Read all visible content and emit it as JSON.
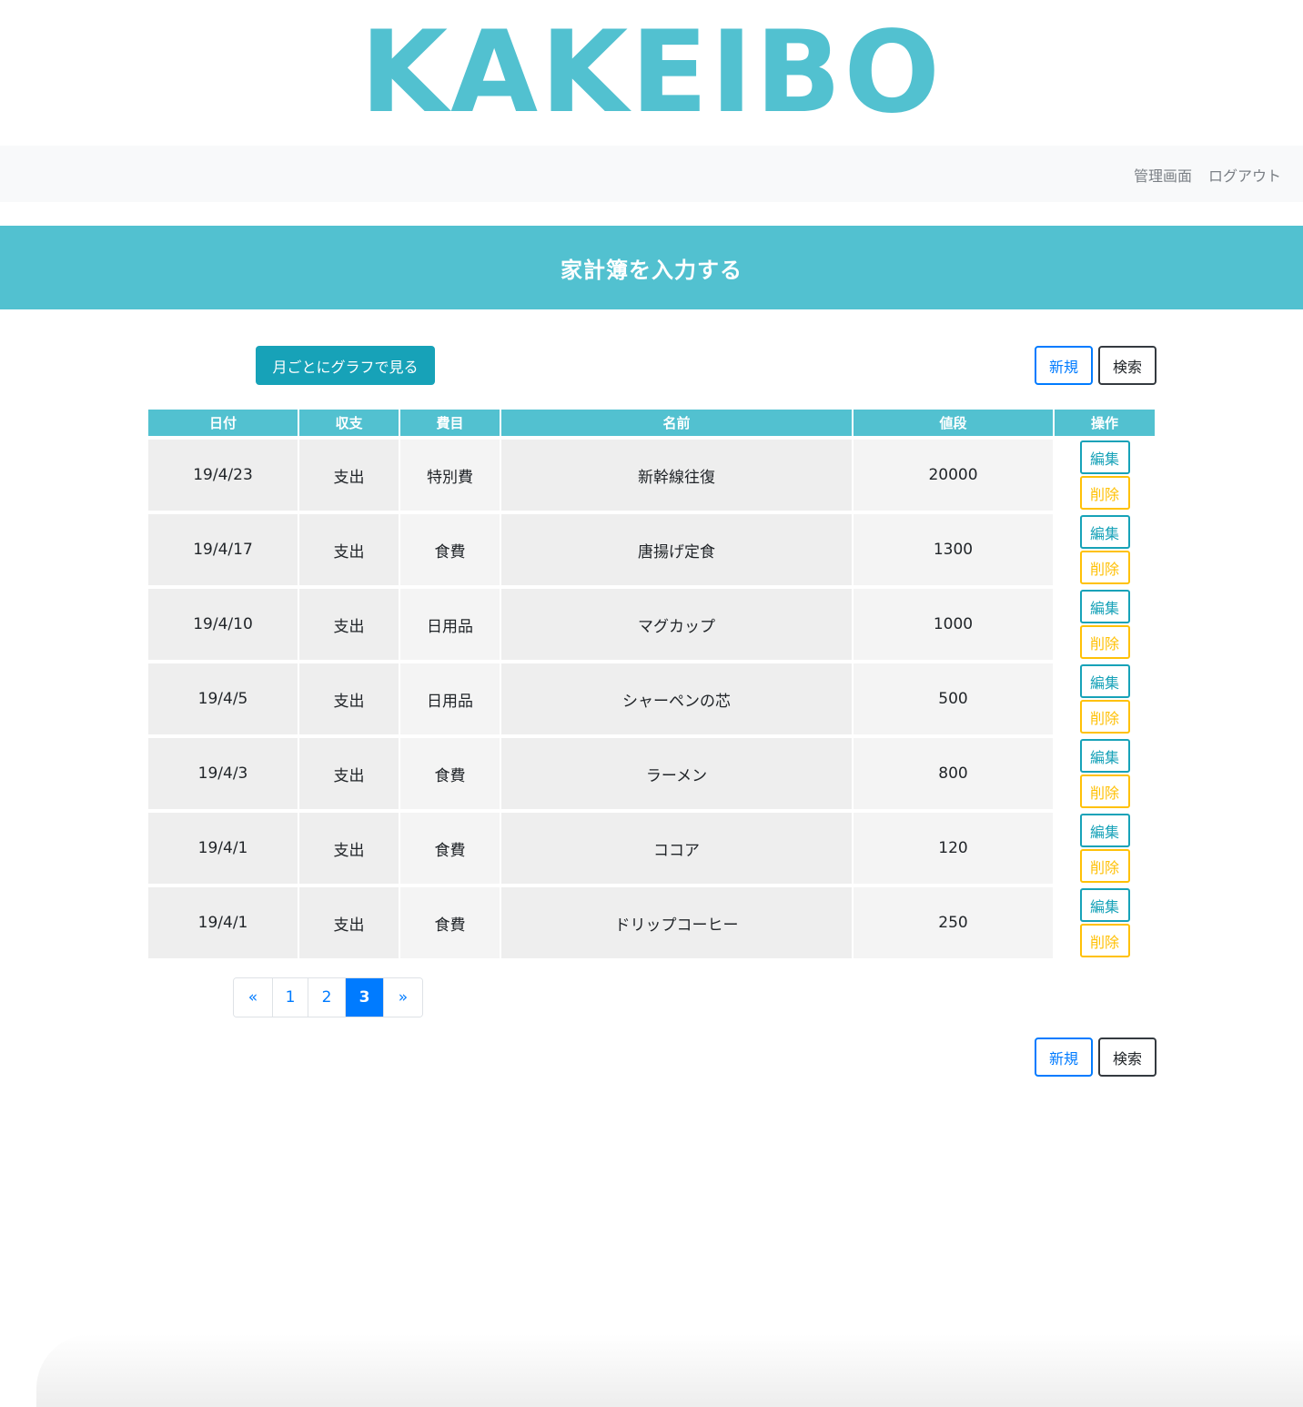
{
  "logo": "KAKEIBO",
  "nav": {
    "admin": "管理画面",
    "logout": "ログアウト"
  },
  "banner_title": "家計簿を入力する",
  "buttons": {
    "graph": "月ごとにグラフで見る",
    "new": "新規",
    "search": "検索"
  },
  "table": {
    "headers": [
      "日付",
      "収支",
      "費目",
      "名前",
      "値段",
      "操作"
    ],
    "rows": [
      {
        "date": "19/4/23",
        "type": "支出",
        "category": "特別費",
        "name": "新幹線往復",
        "price": "20000"
      },
      {
        "date": "19/4/17",
        "type": "支出",
        "category": "食費",
        "name": "唐揚げ定食",
        "price": "1300"
      },
      {
        "date": "19/4/10",
        "type": "支出",
        "category": "日用品",
        "name": "マグカップ",
        "price": "1000"
      },
      {
        "date": "19/4/5",
        "type": "支出",
        "category": "日用品",
        "name": "シャーペンの芯",
        "price": "500"
      },
      {
        "date": "19/4/3",
        "type": "支出",
        "category": "食費",
        "name": "ラーメン",
        "price": "800"
      },
      {
        "date": "19/4/1",
        "type": "支出",
        "category": "食費",
        "name": "ココア",
        "price": "120"
      },
      {
        "date": "19/4/1",
        "type": "支出",
        "category": "食費",
        "name": "ドリップコーヒー",
        "price": "250"
      }
    ],
    "edit_label": "編集",
    "delete_label": "削除"
  },
  "pagination": {
    "prev": "«",
    "pages": [
      "1",
      "2",
      "3"
    ],
    "current": "3",
    "next": "»"
  },
  "colors": {
    "accent": "#52c1d0",
    "primary": "#007bff",
    "info": "#17a2b8",
    "warning": "#ffc107"
  }
}
